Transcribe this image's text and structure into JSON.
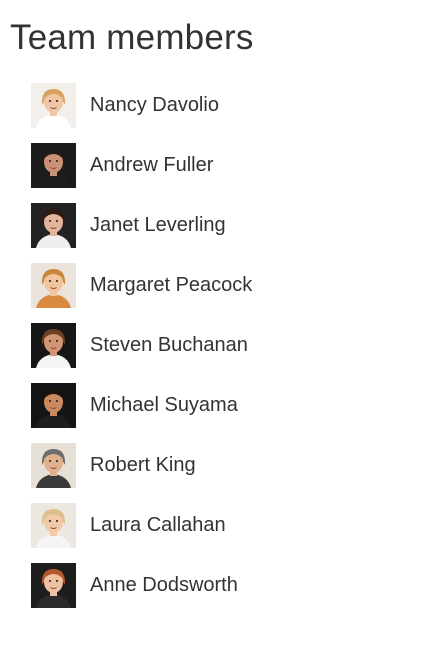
{
  "page": {
    "title": "Team members"
  },
  "members": [
    {
      "name": "Nancy Davolio",
      "avatar_icon": "portrait-icon",
      "bg": "#f3f0ec",
      "skin": "#f0c7a6",
      "hair": "#d7a25f",
      "shirt": "#ffffff"
    },
    {
      "name": "Andrew Fuller",
      "avatar_icon": "portrait-icon",
      "bg": "#1b1b1b",
      "skin": "#c99277",
      "hair": "#221a15",
      "shirt": "#1e1e1e"
    },
    {
      "name": "Janet Leverling",
      "avatar_icon": "portrait-icon",
      "bg": "#222222",
      "skin": "#e3b49a",
      "hair": "#2d1a14",
      "shirt": "#efefef"
    },
    {
      "name": "Margaret Peacock",
      "avatar_icon": "portrait-icon",
      "bg": "#eae4dc",
      "skin": "#f1c59e",
      "hair": "#c9863c",
      "shirt": "#d98a3f"
    },
    {
      "name": "Steven Buchanan",
      "avatar_icon": "portrait-icon",
      "bg": "#161616",
      "skin": "#d39674",
      "hair": "#6a3f22",
      "shirt": "#f5f5f5"
    },
    {
      "name": "Michael Suyama",
      "avatar_icon": "portrait-icon",
      "bg": "#141414",
      "skin": "#c98a5f",
      "hair": "#1a120c",
      "shirt": "#1e1e1e"
    },
    {
      "name": "Robert King",
      "avatar_icon": "portrait-icon",
      "bg": "#e7e0d6",
      "skin": "#e1b08d",
      "hair": "#6d6d6d",
      "shirt": "#3b3b3b"
    },
    {
      "name": "Laura Callahan",
      "avatar_icon": "portrait-icon",
      "bg": "#ece7e0",
      "skin": "#f2c9a9",
      "hair": "#dcbf8a",
      "shirt": "#f5f5f5"
    },
    {
      "name": "Anne Dodsworth",
      "avatar_icon": "portrait-icon",
      "bg": "#1d1d1d",
      "skin": "#efc1a2",
      "hair": "#b4592c",
      "shirt": "#2a2a2a"
    }
  ]
}
